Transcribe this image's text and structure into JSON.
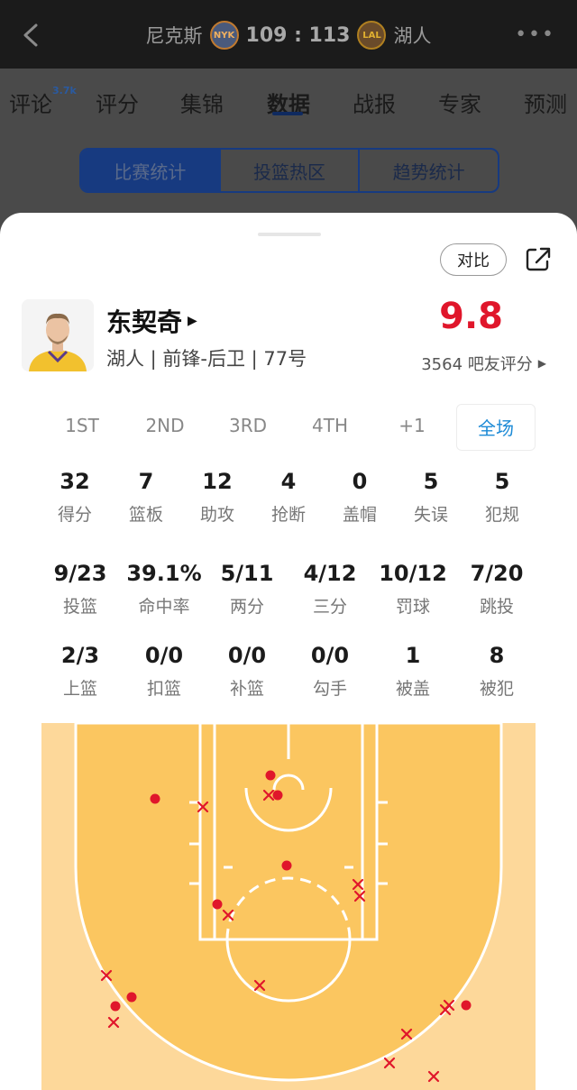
{
  "header": {
    "home_team": "尼克斯",
    "home_logo": "NYK",
    "score": "109 : 113",
    "away_logo": "LAL",
    "away_team": "湖人"
  },
  "tabs": [
    {
      "label": "评论",
      "badge": "3.7k"
    },
    {
      "label": "评分"
    },
    {
      "label": "集锦"
    },
    {
      "label": "数据",
      "active": true
    },
    {
      "label": "战报"
    },
    {
      "label": "专家"
    },
    {
      "label": "预测"
    }
  ],
  "segments": [
    "比赛统计",
    "投篮热区",
    "趋势统计"
  ],
  "sheet": {
    "compare_label": "对比",
    "player": {
      "name": "东契奇",
      "info": "湖人 | 前锋-后卫 | 77号",
      "rating": "9.8",
      "rating_count": "3564 吧友评分"
    },
    "periods": [
      "1ST",
      "2ND",
      "3RD",
      "4TH",
      "+1",
      "全场"
    ],
    "active_period": "全场",
    "stats_row1": [
      {
        "val": "32",
        "lab": "得分"
      },
      {
        "val": "7",
        "lab": "篮板"
      },
      {
        "val": "12",
        "lab": "助攻"
      },
      {
        "val": "4",
        "lab": "抢断"
      },
      {
        "val": "0",
        "lab": "盖帽"
      },
      {
        "val": "5",
        "lab": "失误"
      },
      {
        "val": "5",
        "lab": "犯规"
      }
    ],
    "stats_row2": [
      {
        "val": "9/23",
        "lab": "投篮"
      },
      {
        "val": "39.1%",
        "lab": "命中率"
      },
      {
        "val": "5/11",
        "lab": "两分"
      },
      {
        "val": "4/12",
        "lab": "三分"
      },
      {
        "val": "10/12",
        "lab": "罚球"
      },
      {
        "val": "7/20",
        "lab": "跳投"
      }
    ],
    "stats_row3": [
      {
        "val": "2/3",
        "lab": "上篮"
      },
      {
        "val": "0/0",
        "lab": "扣篮"
      },
      {
        "val": "0/0",
        "lab": "补篮"
      },
      {
        "val": "0/0",
        "lab": "勾手"
      },
      {
        "val": "1",
        "lab": "被盖"
      },
      {
        "val": "8",
        "lab": "被犯"
      }
    ]
  },
  "colors": {
    "court": "#fbc660",
    "court_outer": "#fdd89a",
    "made": "#e0162b",
    "missed": "#e0162b",
    "rating": "#e0162b",
    "accent_blue": "#1c8ad6"
  }
}
